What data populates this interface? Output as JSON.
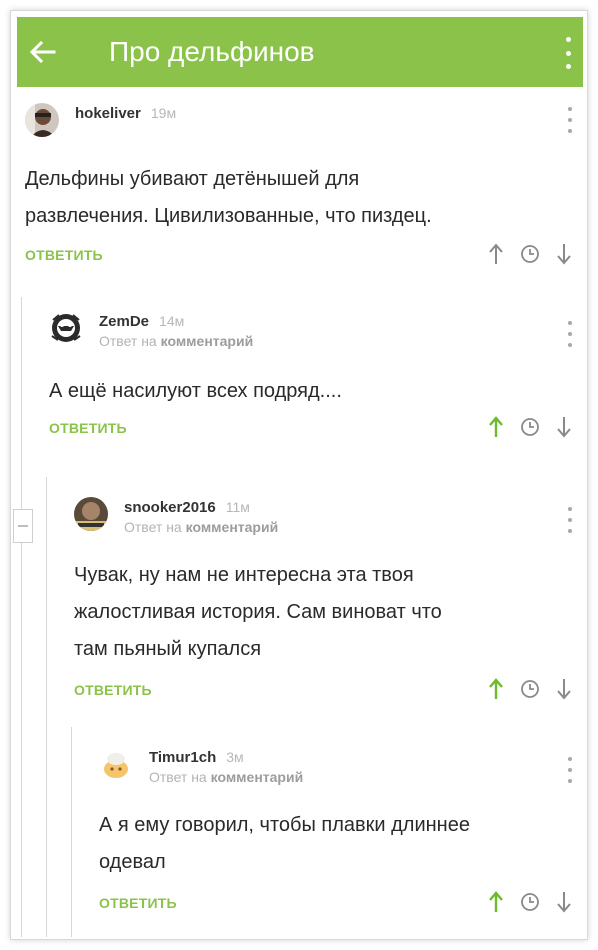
{
  "appbar": {
    "title": "Про дельфинов",
    "back_icon": "arrow-left-icon",
    "menu_icon": "more-vert-icon",
    "color": "#8bc34a"
  },
  "labels": {
    "reply_to_prefix": "Ответ на",
    "reply_to_target": "комментарий"
  },
  "comments": [
    {
      "author": "hokeliver",
      "time": "19м",
      "reply_to": false,
      "text_lines": [
        "Дельфины убивают детёнышей для",
        "развлечения. Цивилизованные, что пиздец."
      ],
      "reply_label": "ОТВЕТИТЬ",
      "upvoted": false
    },
    {
      "author": "ZemDe",
      "time": "14м",
      "reply_to": true,
      "text_lines": [
        "А ещё насилуют всех подряд...."
      ],
      "reply_label": "ОТВЕТИТЬ",
      "upvoted": true
    },
    {
      "author": "snooker2016",
      "time": "11м",
      "reply_to": true,
      "text_lines": [
        "Чувак, ну нам не интересна эта твоя",
        "жалостливая история. Сам виноват что",
        "там пьяный купался"
      ],
      "reply_label": "ОТВЕТИТЬ",
      "upvoted": true
    },
    {
      "author": "Timur1ch",
      "time": "3м",
      "reply_to": true,
      "text_lines": [
        "А я ему говорил, чтобы плавки длиннее",
        "одевал"
      ],
      "reply_label": "ОТВЕТИТЬ",
      "upvoted": true
    }
  ],
  "colors": {
    "accent": "#8bc34a",
    "vote_inactive": "#8a8a8a"
  }
}
